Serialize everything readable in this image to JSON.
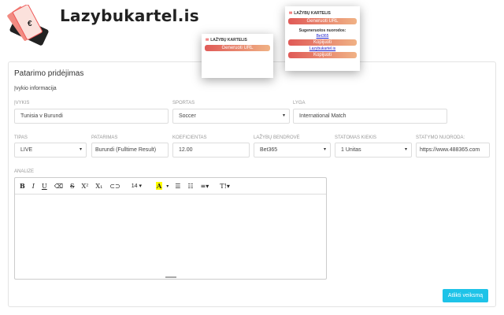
{
  "brand": {
    "name": "Lazybukartel.is"
  },
  "popup_small": {
    "logo": "LAŽYBŲ KARTELIS",
    "generate": "Generuoti URL"
  },
  "popup_large": {
    "logo": "LAŽYBŲ KARTELIS",
    "generate": "Generuoti URL",
    "heading": "Sugeneruotos nuorodos:",
    "link1": "Bet365",
    "copy1": "Kopijuoti",
    "link2": "Lazybukartel.is",
    "copy2": "Kopijuoti"
  },
  "form": {
    "title": "Patarimo pridėjimas",
    "section": "Įvykio informacija",
    "event": {
      "label": "ĮVYKIS",
      "value": "Tunisia v Burundi"
    },
    "sport": {
      "label": "SPORTAS",
      "value": "Soccer"
    },
    "league": {
      "label": "LYGA",
      "value": "International Match"
    },
    "type": {
      "label": "TIPAS",
      "value": "LIVE"
    },
    "tip": {
      "label": "PATARIMAS",
      "value": "Burundi  (Fulltime Result)"
    },
    "odds": {
      "label": "KOEFICIENTAS",
      "value": "12.00"
    },
    "bookmaker": {
      "label": "LAŽYBŲ BENDROVĖ",
      "value": "Bet365"
    },
    "stake": {
      "label": "STATOMAS KIEKIS",
      "value": "1 Unitas"
    },
    "link": {
      "label": "STATYMO NUORODA:",
      "value": "https://www.488365.com"
    },
    "analysis": {
      "label": "ANALIZE",
      "font_size": "14"
    },
    "submit": "Atlikti veiksmą"
  },
  "colors": {
    "accent": "#1ec3e8",
    "gradient_start": "#e05a57",
    "gradient_end": "#f0b285"
  }
}
